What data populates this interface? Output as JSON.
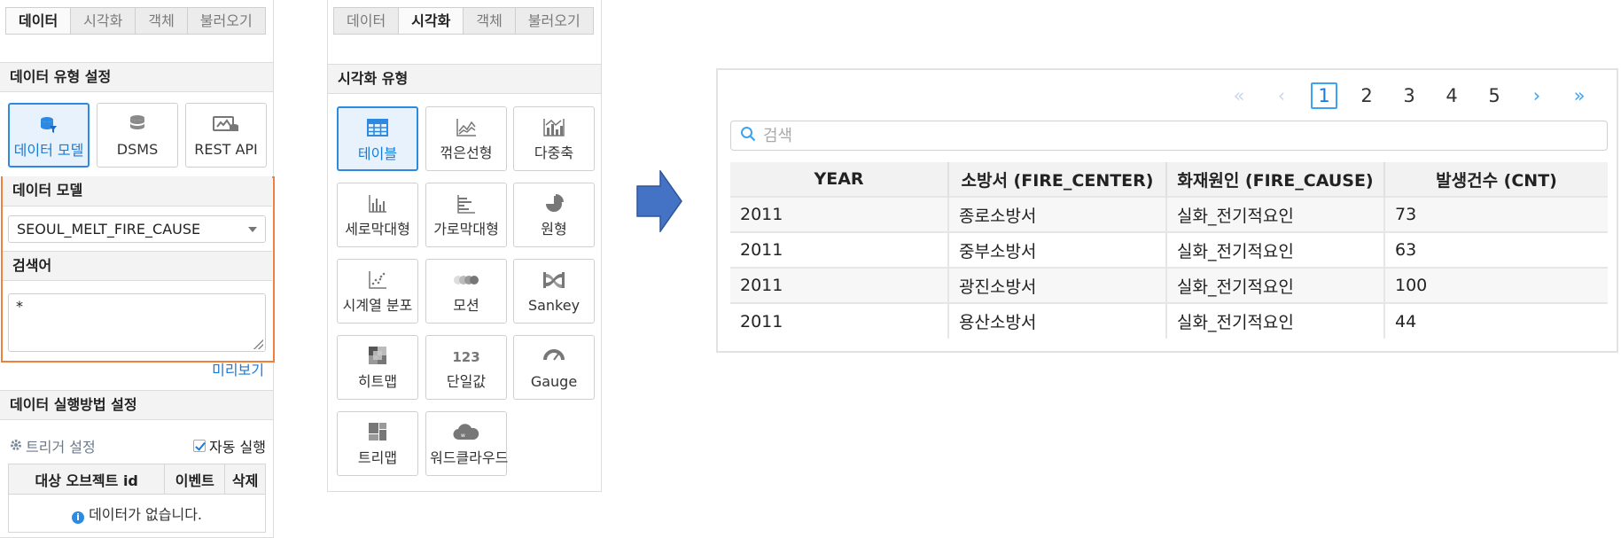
{
  "left": {
    "tabs": [
      {
        "label": "데이터",
        "active": true
      },
      {
        "label": "시각화",
        "active": false
      },
      {
        "label": "객체",
        "active": false
      },
      {
        "label": "불러오기",
        "active": false
      }
    ],
    "data_type_title": "데이터 유형 설정",
    "data_types": [
      {
        "label": "데이터 모델",
        "icon": "data-model-icon",
        "selected": true
      },
      {
        "label": "DSMS",
        "icon": "database-icon",
        "selected": false
      },
      {
        "label": "REST API",
        "icon": "api-icon",
        "selected": false
      }
    ],
    "model_title": "데이터 모델",
    "model_value": "SEOUL_MELT_FIRE_CAUSE",
    "keyword_title": "검색어",
    "keyword_value": "*",
    "preview_link": "미리보기",
    "exec_title": "데이터 실행방법 설정",
    "trigger_label": "트리거 설정",
    "autorun_label": "자동 실행",
    "autorun_checked": true,
    "table_headers": [
      "대상 오브젝트 id",
      "이벤트",
      "삭제"
    ],
    "empty_message": "데이터가 없습니다."
  },
  "middle": {
    "tabs": [
      {
        "label": "데이터",
        "active": false
      },
      {
        "label": "시각화",
        "active": true
      },
      {
        "label": "객체",
        "active": false
      },
      {
        "label": "불러오기",
        "active": false
      }
    ],
    "viz_type_title": "시각화 유형",
    "viz_types": [
      {
        "label": "테이블",
        "icon": "table-icon",
        "selected": true
      },
      {
        "label": "꺾은선형",
        "icon": "line-chart-icon",
        "selected": false
      },
      {
        "label": "다중축",
        "icon": "multi-axis-icon",
        "selected": false
      },
      {
        "label": "세로막대형",
        "icon": "column-chart-icon",
        "selected": false
      },
      {
        "label": "가로막대형",
        "icon": "bar-chart-icon",
        "selected": false
      },
      {
        "label": "원형",
        "icon": "pie-chart-icon",
        "selected": false
      },
      {
        "label": "시계열 분포",
        "icon": "timeseries-icon",
        "selected": false
      },
      {
        "label": "모션",
        "icon": "motion-icon",
        "selected": false
      },
      {
        "label": "Sankey",
        "icon": "sankey-icon",
        "selected": false
      },
      {
        "label": "히트맵",
        "icon": "heatmap-icon",
        "selected": false
      },
      {
        "label": "단일값",
        "icon": "single-value-icon",
        "selected": false,
        "icon_text": "123"
      },
      {
        "label": "Gauge",
        "icon": "gauge-icon",
        "selected": false
      },
      {
        "label": "트리맵",
        "icon": "treemap-icon",
        "selected": false
      },
      {
        "label": "워드클라우드",
        "icon": "wordcloud-icon",
        "selected": false
      }
    ]
  },
  "preview": {
    "pagination": {
      "pages": [
        "1",
        "2",
        "3",
        "4",
        "5"
      ],
      "current": "1"
    },
    "search_placeholder": "검색",
    "columns": [
      "YEAR",
      "소방서 (FIRE_CENTER)",
      "화재원인 (FIRE_CAUSE)",
      "발생건수 (CNT)"
    ],
    "rows": [
      [
        "2011",
        "종로소방서",
        "실화_전기적요인",
        "73"
      ],
      [
        "2011",
        "중부소방서",
        "실화_전기적요인",
        "63"
      ],
      [
        "2011",
        "광진소방서",
        "실화_전기적요인",
        "100"
      ],
      [
        "2011",
        "용산소방서",
        "실화_전기적요인",
        "44"
      ]
    ]
  },
  "colors": {
    "accent": "#2d8ae0",
    "highlight_border": "#f0813c",
    "arrow": "#4472c4"
  }
}
